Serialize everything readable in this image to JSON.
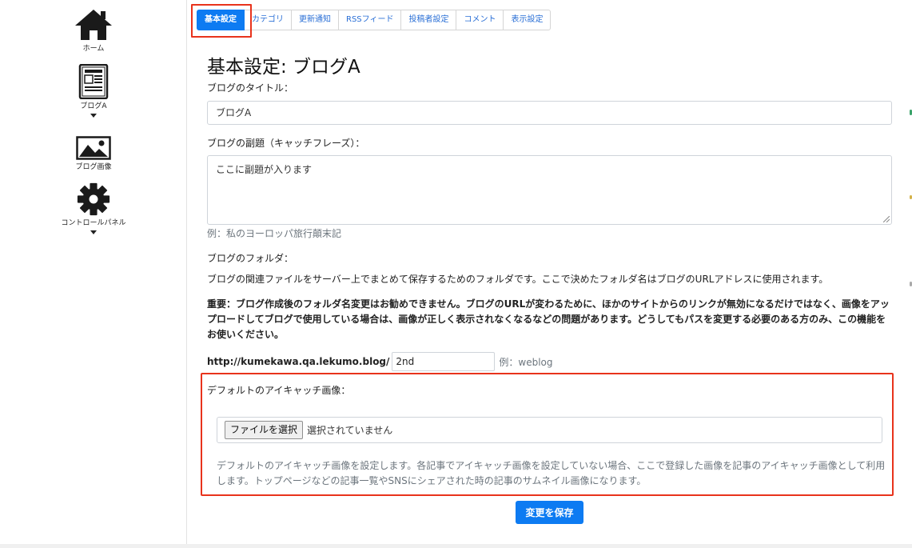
{
  "sidebar": {
    "items": [
      {
        "label": "ホーム",
        "icon": "home-icon"
      },
      {
        "label": "ブログA",
        "icon": "blog-document-icon"
      },
      {
        "label": "ブログ画像",
        "icon": "image-icon"
      },
      {
        "label": "コントロールパネル",
        "icon": "gear-icon"
      }
    ]
  },
  "tabs": [
    {
      "label": "基本設定",
      "active": true
    },
    {
      "label": "カテゴリ",
      "active": false
    },
    {
      "label": "更新通知",
      "active": false
    },
    {
      "label": "RSSフィード",
      "active": false
    },
    {
      "label": "投稿者設定",
      "active": false
    },
    {
      "label": "コメント",
      "active": false
    },
    {
      "label": "表示設定",
      "active": false
    }
  ],
  "main": {
    "page_title": "基本設定: ブログA",
    "title_label": "ブログのタイトル：",
    "title_value": "ブログA",
    "subtitle_label": "ブログの副題（キャッチフレーズ）：",
    "subtitle_value": "ここに副題が入ります",
    "subtitle_example": "例：私のヨーロッパ旅行顛末記",
    "folder_label": "ブログのフォルダ：",
    "folder_description": "ブログの関連ファイルをサーバー上でまとめて保存するためのフォルダです。ここで決めたフォルダ名はブログのURLアドレスに使用されます。",
    "folder_warning": "重要：ブログ作成後のフォルダ名変更はお勧めできません。ブログのURLが変わるために、ほかのサイトからのリンクが無効になるだけではなく、画像をアップロードしてブログで使用している場合は、画像が正しく表示されなくなるなどの問題があります。どうしてもパスを変更する必要のある方のみ、この機能をお使いください。",
    "url_prefix": "http://kumekawa.qa.lekumo.blog/",
    "folder_value": "2nd",
    "folder_example": "例：weblog",
    "eyecatch_label": "デフォルトのアイキャッチ画像：",
    "file_button": "ファイルを選択",
    "file_status": "選択されていません",
    "eyecatch_help": "デフォルトのアイキャッチ画像を設定します。各記事でアイキャッチ画像を設定していない場合、ここで登録した画像を記事のアイキャッチ画像として利用します。トップページなどの記事一覧やSNSにシェアされた時の記事のサムネイル画像になります。",
    "save_button": "変更を保存"
  },
  "colors": {
    "accent": "#0d7bf2",
    "highlight": "#e8331c",
    "tab_text": "#2a6fd6",
    "muted_text": "#6c757d"
  }
}
